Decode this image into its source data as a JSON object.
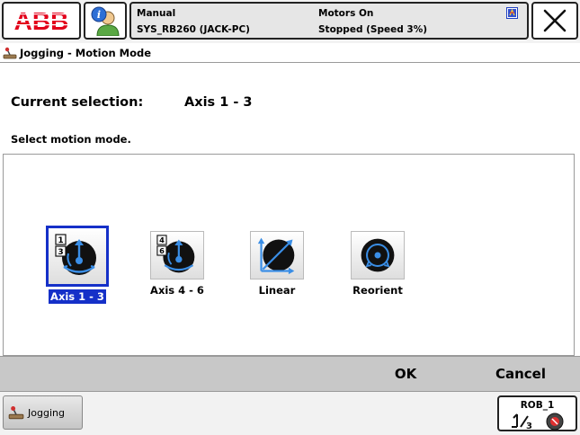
{
  "header": {
    "logo_text": "ABB",
    "mode": "Manual",
    "system": "SYS_RB260 (JACK-PC)",
    "motors": "Motors On",
    "state": "Stopped (Speed 3%)"
  },
  "title": {
    "label": "Jogging - Motion Mode"
  },
  "selection": {
    "current_label": "Current selection:",
    "current_value": "Axis 1 - 3",
    "instruction": "Select motion mode."
  },
  "modes": [
    {
      "label": "Axis 1 - 3",
      "selected": true
    },
    {
      "label": "Axis 4 - 6",
      "selected": false
    },
    {
      "label": "Linear",
      "selected": false
    },
    {
      "label": "Reorient",
      "selected": false
    }
  ],
  "commands": {
    "ok": "OK",
    "cancel": "Cancel"
  },
  "taskbar": {
    "jogging": "Jogging",
    "robot": "ROB_1"
  },
  "colors": {
    "abb_red": "#e2001a",
    "selection_blue": "#1530c8",
    "icon_blue": "#3a8ee6"
  }
}
